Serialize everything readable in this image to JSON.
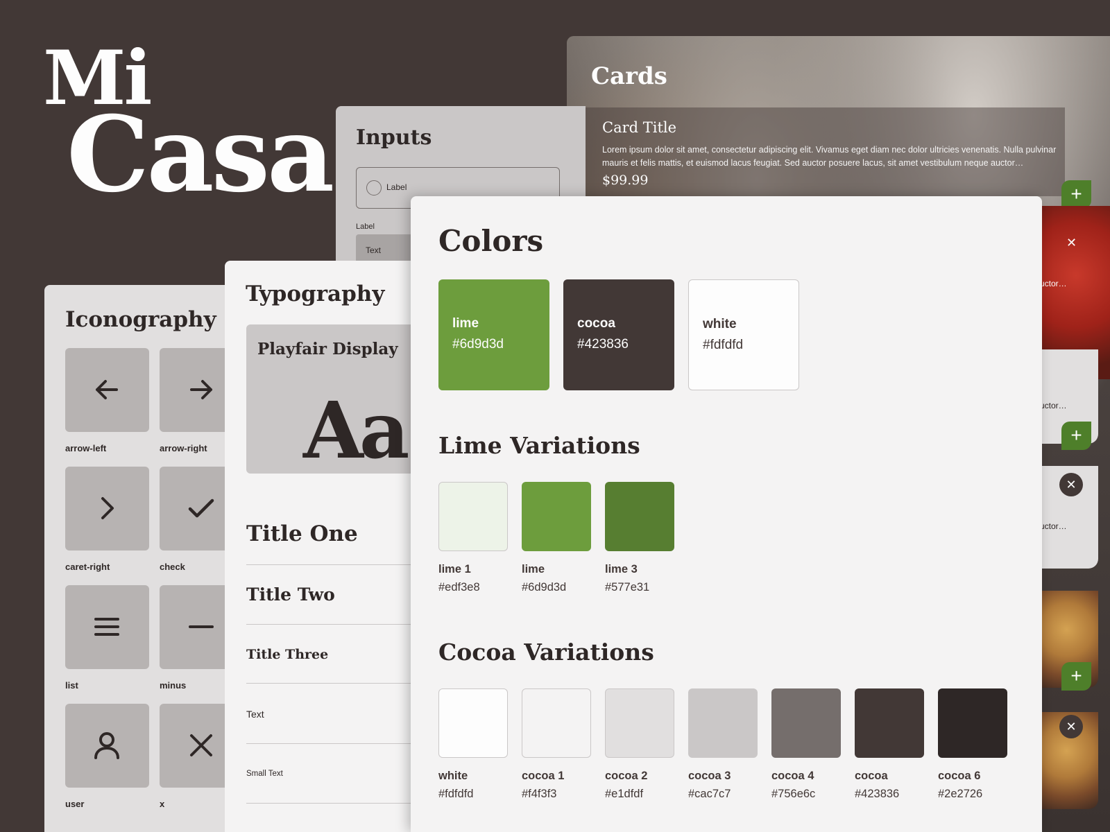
{
  "logo": {
    "line1": "Mi",
    "line2": "Casa"
  },
  "cards": {
    "title": "Cards",
    "card_title": "Card Title",
    "card_desc": "Lorem ipsum dolor sit amet, consectetur adipiscing elit. Vivamus eget diam nec dolor ultricies venenatis. Nulla pulvinar mauris et felis mattis, et euismod lacus feugiat. Sed auctor posuere lacus, sit amet vestibulum neque auctor…",
    "card_price": "$99.99",
    "truncated_text": "uctor…",
    "add_symbol": "+",
    "close_symbol": "✕"
  },
  "inputs": {
    "title": "Inputs",
    "radio_label": "Label",
    "text_label": "Label",
    "text_value": "Text"
  },
  "iconography": {
    "title": "Iconography",
    "icons": [
      {
        "name": "arrow-left"
      },
      {
        "name": "arrow-right"
      },
      {
        "name": "caret-right"
      },
      {
        "name": "check"
      },
      {
        "name": "list"
      },
      {
        "name": "minus"
      },
      {
        "name": "user"
      },
      {
        "name": "x"
      }
    ]
  },
  "typography": {
    "title": "Typography",
    "font_name": "Playfair Display",
    "font_sample": "Aa",
    "styles": [
      "Title One",
      "Title Two",
      "Title Three",
      "Text",
      "Small Text"
    ]
  },
  "colors": {
    "title": "Colors",
    "main": [
      {
        "name": "lime",
        "hex": "#6d9d3d",
        "fill": "#6d9d3d",
        "text_color": "#fdfdfd"
      },
      {
        "name": "cocoa",
        "hex": "#423836",
        "fill": "#423836",
        "text_color": "#fdfdfd"
      },
      {
        "name": "white",
        "hex": "#fdfdfd",
        "fill": "#fdfdfd",
        "text_color": "#423836"
      }
    ],
    "lime_title": "Lime Variations",
    "lime": [
      {
        "name": "lime 1",
        "hex": "#edf3e8"
      },
      {
        "name": "lime",
        "hex": "#6d9d3d"
      },
      {
        "name": "lime 3",
        "hex": "#577e31"
      }
    ],
    "cocoa_title": "Cocoa Variations",
    "cocoa": [
      {
        "name": "white",
        "hex": "#fdfdfd"
      },
      {
        "name": "cocoa 1",
        "hex": "#f4f3f3"
      },
      {
        "name": "cocoa 2",
        "hex": "#e1dfdf"
      },
      {
        "name": "cocoa 3",
        "hex": "#cac7c7"
      },
      {
        "name": "cocoa 4",
        "hex": "#756e6c"
      },
      {
        "name": "cocoa",
        "hex": "#423836"
      },
      {
        "name": "cocoa 6",
        "hex": "#2e2726"
      }
    ]
  }
}
